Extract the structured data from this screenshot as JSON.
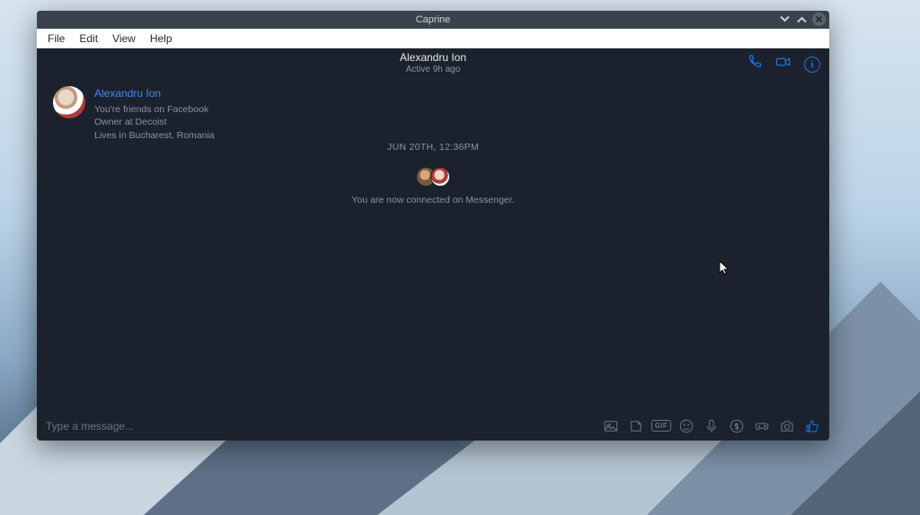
{
  "window": {
    "title": "Caprine"
  },
  "menubar": {
    "file": "File",
    "edit": "Edit",
    "view": "View",
    "help": "Help"
  },
  "chat_header": {
    "name": "Alexandru Ion",
    "status": "Active 9h ago"
  },
  "intro": {
    "name": "Alexandru Ion",
    "line1": "You're friends on Facebook",
    "line2": "Owner at Decoist",
    "line3": "Lives in Bucharest, Romania"
  },
  "timeline": {
    "timestamp": "JUN 20TH, 12:36PM",
    "connected_text": "You are now connected on Messenger."
  },
  "composer": {
    "placeholder": "Type a message..."
  }
}
